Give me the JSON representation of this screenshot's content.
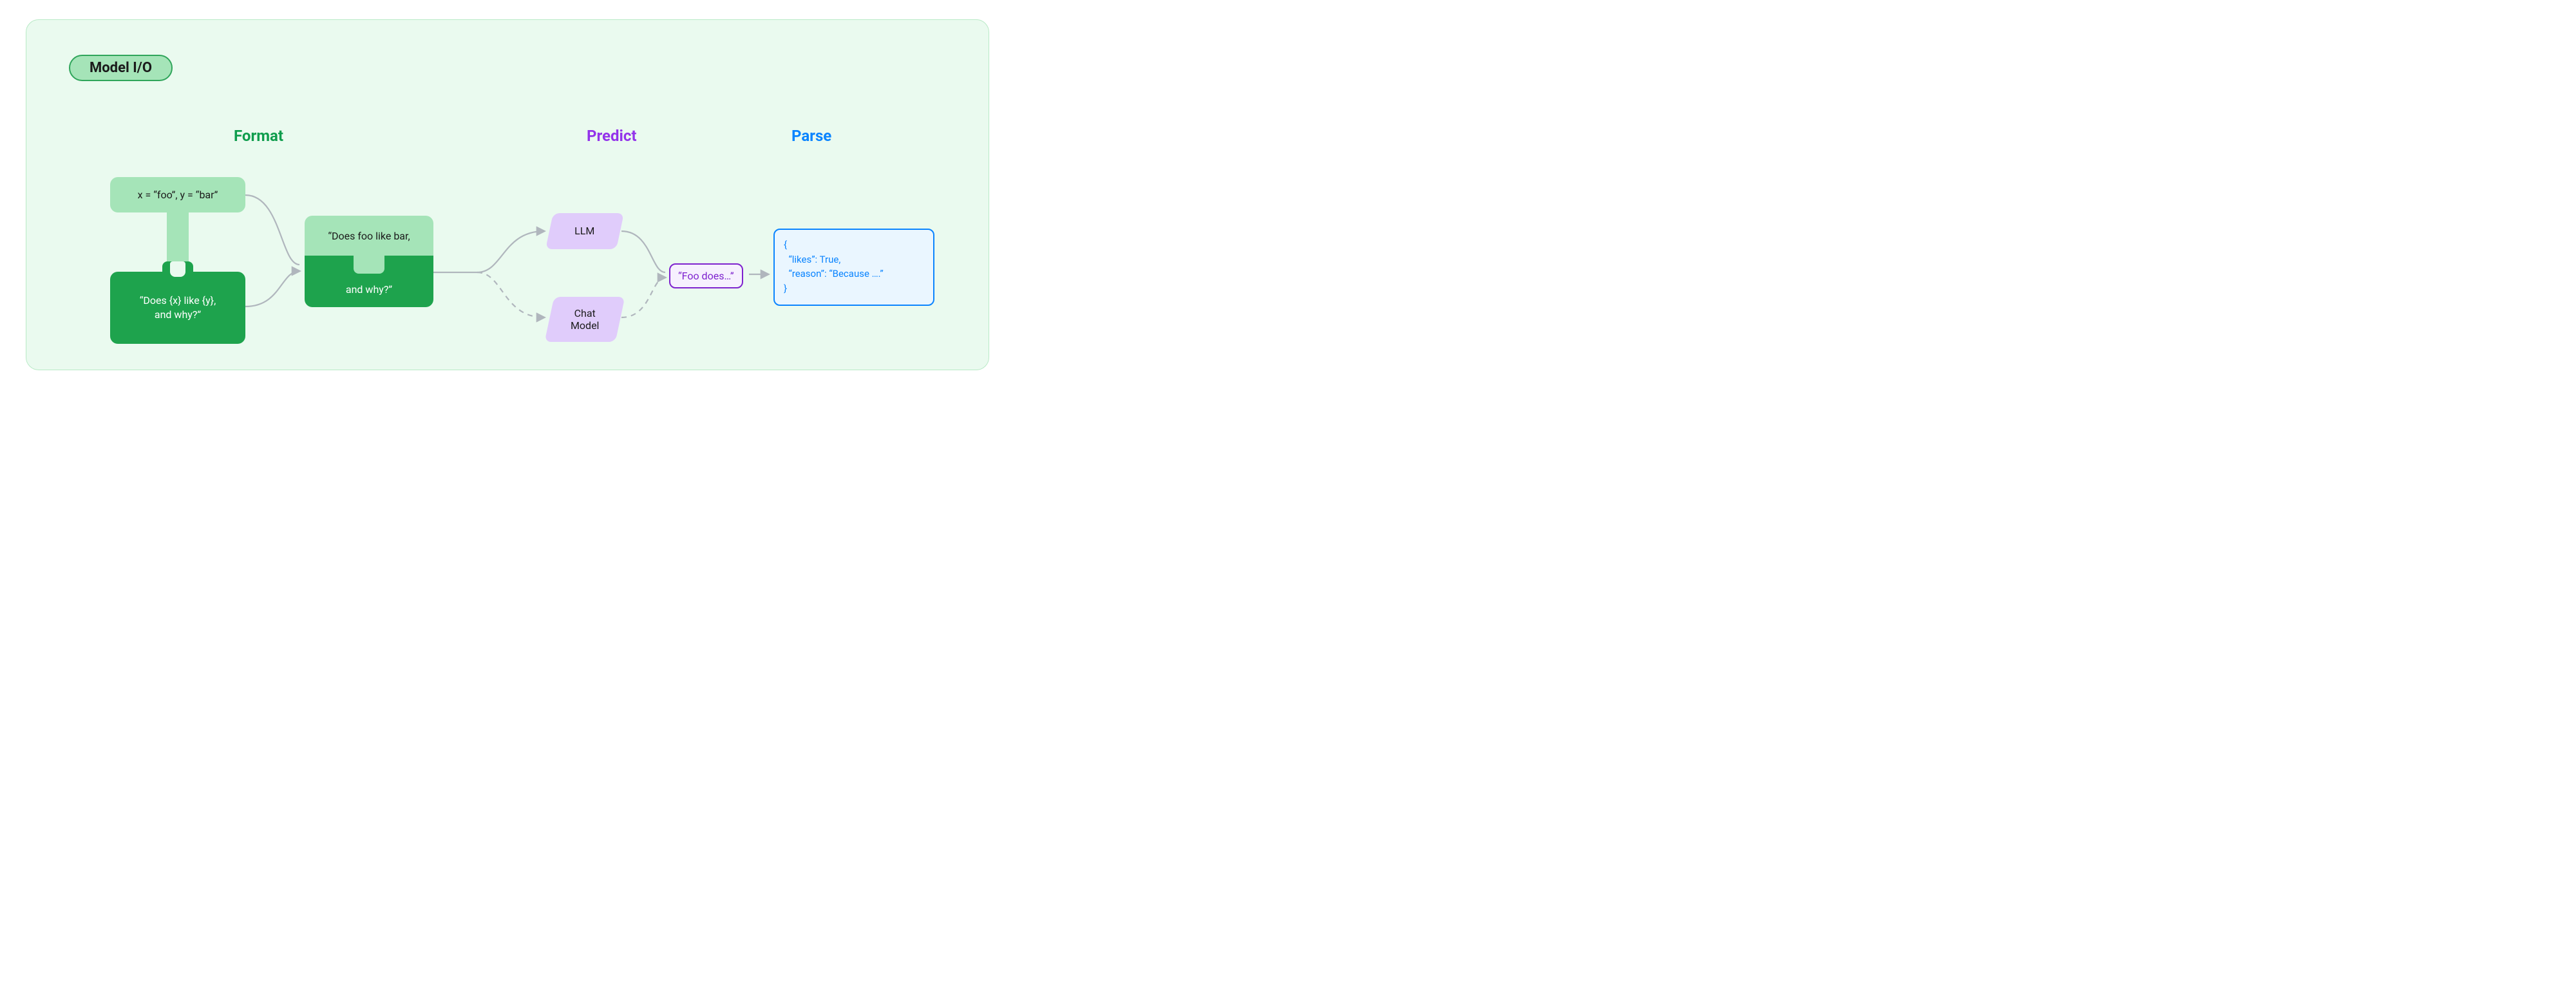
{
  "header": {
    "badge": "Model I/O"
  },
  "sections": {
    "format": "Format",
    "predict": "Predict",
    "parse": "Parse"
  },
  "format": {
    "input_vars": "x = “foo”, y = “bar”",
    "template_l1": "“Does {x} like {y},",
    "template_l2": "and why?”",
    "filled_l1": "“Does foo like bar,",
    "filled_l2": "and why?”"
  },
  "predict": {
    "llm_label": "LLM",
    "chat_label_l1": "Chat",
    "chat_label_l2": "Model",
    "output": "“Foo does…”"
  },
  "parse": {
    "line1": "{",
    "line2": "  “likes”: True,",
    "line3": "  “reason”: “Because ….”",
    "line4": "}"
  },
  "colors": {
    "panel_bg": "#eafaef",
    "light_green": "#a5e4b8",
    "deep_green": "#1ea34d",
    "format_heading": "#0f9d4d",
    "predict_heading": "#9333ea",
    "parse_heading": "#0a84ff",
    "predict_fill": "#e0ccfb",
    "predict_border": "#7e22ce",
    "parse_fill": "#eaf6ff",
    "parse_border": "#0a84ff",
    "arrow": "#b0b6bd"
  }
}
